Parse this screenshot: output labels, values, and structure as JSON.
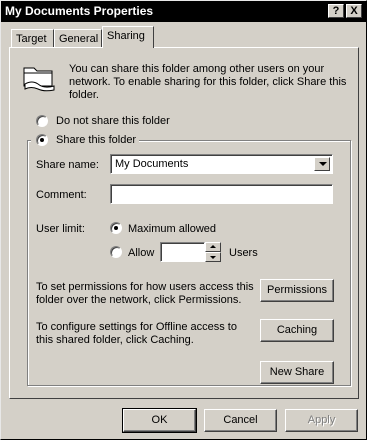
{
  "window": {
    "title": "My Documents Properties"
  },
  "titlebar": {
    "help_label": "?",
    "close_label": "X"
  },
  "tabs": [
    {
      "label": "Target"
    },
    {
      "label": "General"
    },
    {
      "label": "Sharing",
      "active": true
    }
  ],
  "sharing": {
    "intro_line1": "You can share this folder among other users on your",
    "intro_line2": "network.  To enable sharing for this folder, click Share this",
    "intro_line3": "folder.",
    "do_not_share_label": "Do not share this folder",
    "share_label": "Share this folder",
    "selected_option": "Share this folder",
    "share_name_label": "Share name:",
    "share_name_value": "My Documents",
    "comment_label": "Comment:",
    "comment_value": "",
    "user_limit_label": "User limit:",
    "maximum_allowed_label": "Maximum allowed",
    "allow_label": "Allow",
    "allow_value": "",
    "users_label": "Users",
    "user_limit_selected": "Maximum allowed",
    "permissions_text_line1": "To set permissions for how users access this",
    "permissions_text_line2": "folder over the network, click Permissions.",
    "permissions_button": "Permissions",
    "caching_text_line1": "To configure settings for Offline access to",
    "caching_text_line2": "this shared folder, click Caching.",
    "caching_button": "Caching",
    "new_share_button": "New Share"
  },
  "footer": {
    "ok_label": "OK",
    "cancel_label": "Cancel",
    "apply_label": "Apply",
    "apply_enabled": false
  },
  "icons": {
    "folder": "shared-folder-icon",
    "help": "help-icon",
    "close": "close-icon"
  }
}
